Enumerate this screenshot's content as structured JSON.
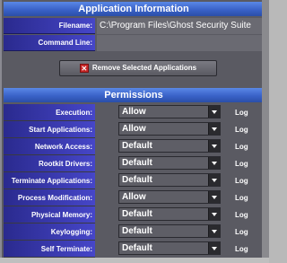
{
  "app_info": {
    "header": "Application Information",
    "filename_label": "Filename:",
    "filename_value": "C:\\Program Files\\Ghost Security Suite",
    "command_line_label": "Command Line:",
    "command_line_value": "",
    "remove_button_label": "Remove Selected Applications"
  },
  "permissions": {
    "header": "Permissions",
    "log_label": "Log",
    "rows": [
      {
        "label": "Execution:",
        "value": "Allow"
      },
      {
        "label": "Start Applications:",
        "value": "Allow"
      },
      {
        "label": "Network Access:",
        "value": "Default"
      },
      {
        "label": "Rootkit Drivers:",
        "value": "Default"
      },
      {
        "label": "Terminate Applications:",
        "value": "Default"
      },
      {
        "label": "Process Modification:",
        "value": "Allow"
      },
      {
        "label": "Physical Memory:",
        "value": "Default"
      },
      {
        "label": "Keylogging:",
        "value": "Default"
      },
      {
        "label": "Self Terminate:",
        "value": "Default"
      }
    ]
  },
  "icons": {
    "remove_icon": "red-x-icon",
    "dropdown_icon": "chevron-down-icon"
  }
}
